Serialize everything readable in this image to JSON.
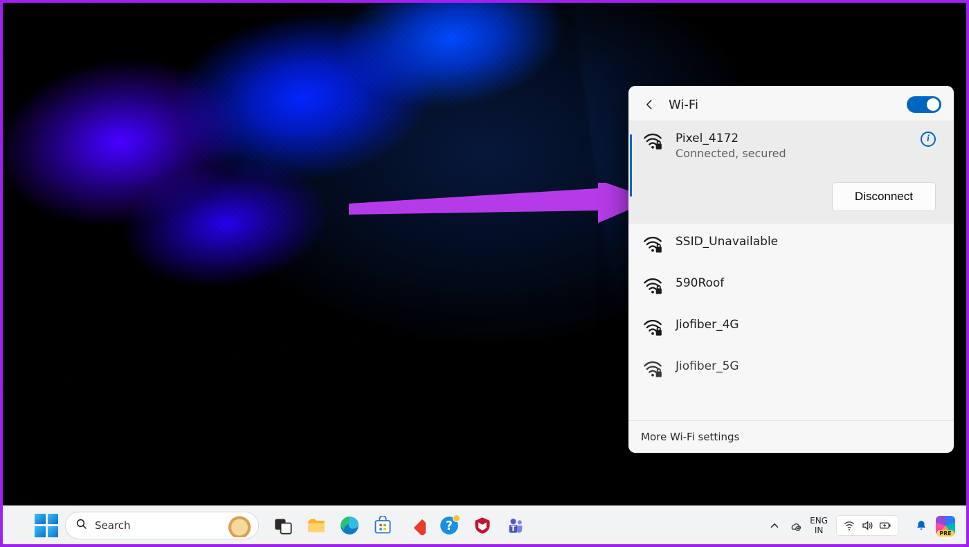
{
  "panel": {
    "title": "Wi-Fi",
    "toggle_on": true,
    "connected": {
      "ssid": "Pixel_4172",
      "state": "Connected, secured",
      "disconnect_label": "Disconnect"
    },
    "networks": [
      {
        "ssid": "SSID_Unavailable"
      },
      {
        "ssid": "590Roof"
      },
      {
        "ssid": "Jiofiber_4G"
      },
      {
        "ssid": "Jiofiber_5G"
      }
    ],
    "footer": "More Wi-Fi settings"
  },
  "taskbar": {
    "search_placeholder": "Search",
    "apps": [
      "task-view",
      "file-explorer",
      "edge",
      "microsoft-store",
      "todo",
      "get-help",
      "mcafee",
      "teams"
    ],
    "lang_top": "ENG",
    "lang_bottom": "IN",
    "clock_time": "",
    "clock_date": ""
  }
}
